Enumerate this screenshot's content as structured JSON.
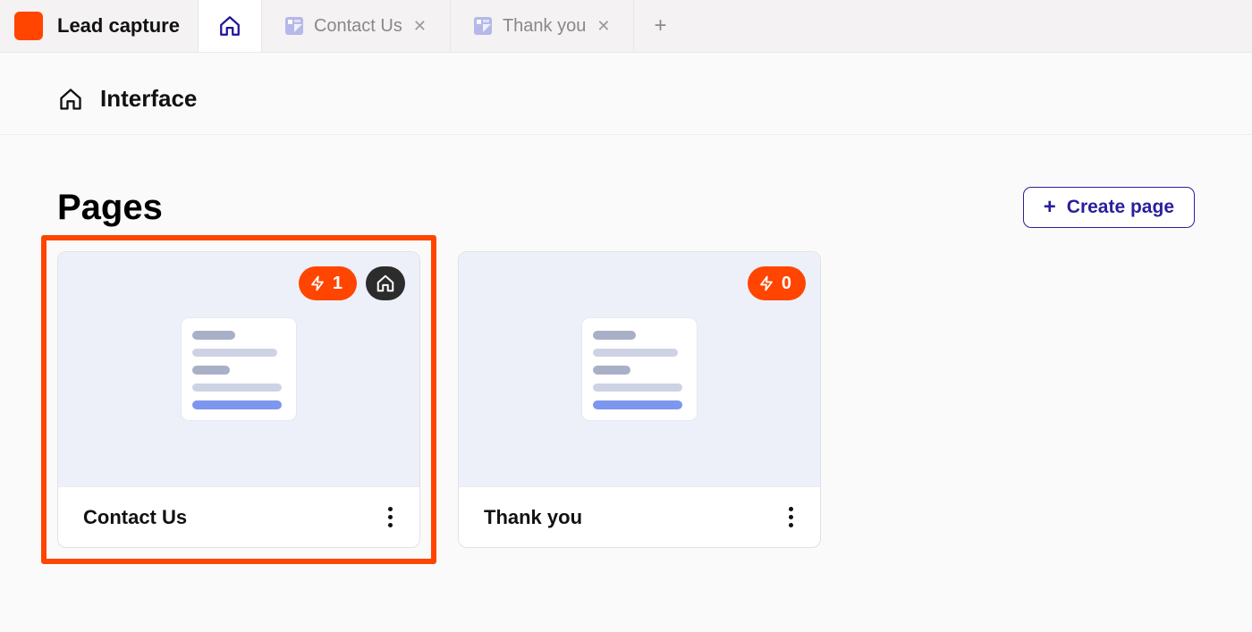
{
  "brand": {
    "name": "Lead capture",
    "accent": "#ff4500"
  },
  "tabs": [
    {
      "type": "home"
    },
    {
      "type": "page",
      "label": "Contact Us",
      "closable": true
    },
    {
      "type": "page",
      "label": "Thank you",
      "closable": true
    },
    {
      "type": "add"
    }
  ],
  "header": {
    "title": "Interface"
  },
  "section": {
    "title": "Pages",
    "create_label": "Create page"
  },
  "pages": [
    {
      "name": "Contact Us",
      "automations": 1,
      "is_home": true,
      "highlighted": true
    },
    {
      "name": "Thank you",
      "automations": 0,
      "is_home": false,
      "highlighted": false
    }
  ]
}
